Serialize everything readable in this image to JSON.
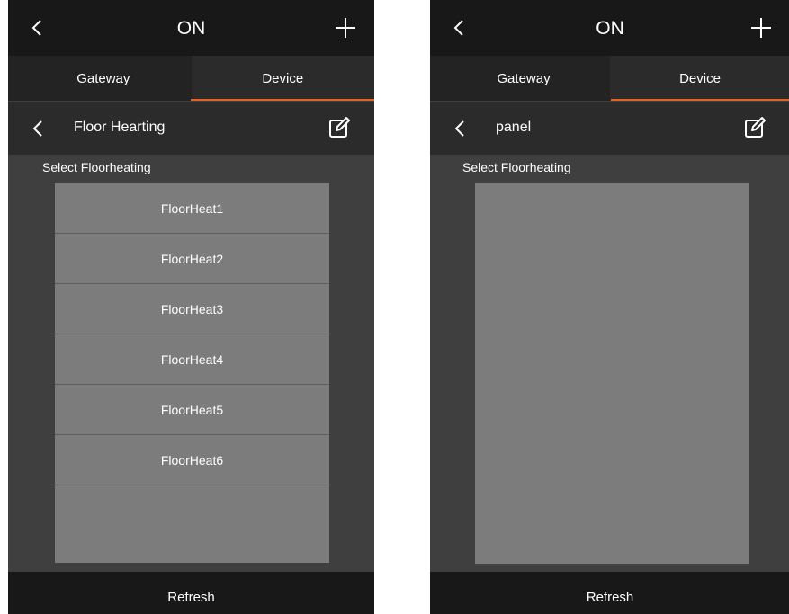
{
  "screens": [
    {
      "title": "ON",
      "tabs": [
        "Gateway",
        "Device"
      ],
      "subtitle": "Floor Hearting",
      "section_label": "Select Floorheating",
      "items": [
        "FloorHeat1",
        "FloorHeat2",
        "FloorHeat3",
        "FloorHeat4",
        "FloorHeat5",
        "FloorHeat6"
      ],
      "footer_button": "Refresh"
    },
    {
      "title": "ON",
      "tabs": [
        "Gateway",
        "Device"
      ],
      "subtitle": "panel",
      "section_label": "Select Floorheating",
      "items": [],
      "footer_button": "Refresh"
    }
  ],
  "colors": {
    "accent": "#e8631f",
    "topbar": "#181818",
    "background": "#3f3f3f",
    "list": "#7c7c7c"
  },
  "icons": [
    "chevron-left-icon",
    "plus-icon",
    "edit-icon"
  ]
}
